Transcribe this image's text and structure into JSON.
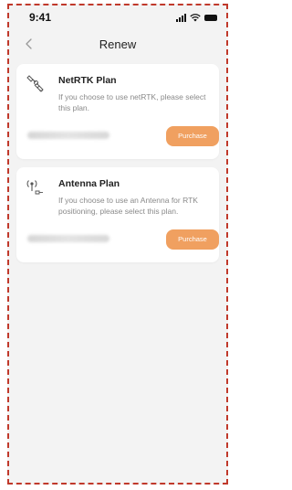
{
  "status_bar": {
    "time": "9:41"
  },
  "nav": {
    "title": "Renew",
    "back_icon": "chevron-left-icon"
  },
  "plans": [
    {
      "icon": "satellite-icon",
      "title": "NetRTK Plan",
      "description": "If you choose to use netRTK, please select this plan.",
      "purchase_label": "Purchase"
    },
    {
      "icon": "antenna-icon",
      "title": "Antenna Plan",
      "description": "If you choose to use an Antenna for RTK positioning, please select this plan.",
      "purchase_label": "Purchase"
    }
  ],
  "colors": {
    "accent": "#f0a060",
    "frame_border": "#c0392b",
    "background": "#f3f3f3"
  }
}
